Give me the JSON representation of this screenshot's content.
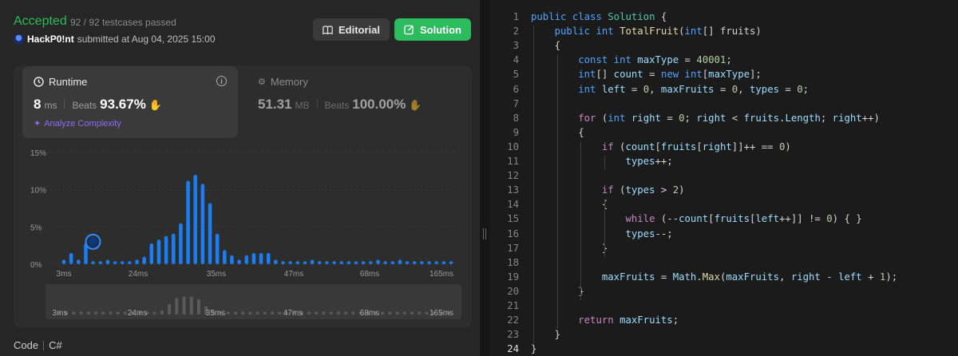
{
  "status": {
    "label": "Accepted",
    "testcases": "92 / 92 testcases passed",
    "user": "HackP0!nt",
    "submitted_text": "submitted at Aug 04, 2025 15:00"
  },
  "buttons": {
    "editorial": "Editorial",
    "solution": "Solution"
  },
  "runtime": {
    "title": "Runtime",
    "value": "8",
    "unit": "ms",
    "beats_label": "Beats",
    "beats_pct": "93.67%",
    "analyze": "Analyze Complexity"
  },
  "memory": {
    "title": "Memory",
    "value": "51.31",
    "unit": "MB",
    "beats_label": "Beats",
    "beats_pct": "100.00%"
  },
  "chart_data": {
    "type": "bar",
    "y_ticks": [
      "15%",
      "10%",
      "5%",
      "0%"
    ],
    "ylim": [
      0,
      15
    ],
    "x_ticks": [
      "3ms",
      "24ms",
      "35ms",
      "47ms",
      "68ms",
      "165ms"
    ],
    "values": [
      0.6,
      1.5,
      0.6,
      2.8,
      0.4,
      0.4,
      0.6,
      0.4,
      0.4,
      0.4,
      0.6,
      1.0,
      2.8,
      3.3,
      3.8,
      4.1,
      5.5,
      11.2,
      12.0,
      10.8,
      8.2,
      4.1,
      1.9,
      1.2,
      0.6,
      1.2,
      1.5,
      1.5,
      1.5,
      0.6,
      0.4,
      0.4,
      0.4,
      0.4,
      0.6,
      0.4,
      0.4,
      0.4,
      0.4,
      0.4,
      0.4,
      0.4,
      0.4,
      0.6,
      0.4,
      0.4,
      0.6,
      0.4,
      0.4,
      0.4,
      0.4,
      0.4,
      0.4,
      0.4
    ],
    "highlight_index": 3,
    "bar_color": "#1a7ef2",
    "mini_values": [
      0.4,
      0.4,
      0.4,
      0.4,
      0.4,
      0.4,
      0.4,
      0.4,
      0.4,
      0.4,
      0.4,
      0.4,
      0.4,
      0.4,
      0.6,
      1.5,
      2.4,
      2.6,
      2.6,
      2.2,
      1.2,
      0.6,
      0.4,
      0.4,
      0.4,
      0.4,
      0.4,
      0.4,
      0.4,
      0.4,
      0.4,
      0.4,
      0.4,
      0.4,
      0.4,
      0.4,
      0.4,
      0.4,
      0.4,
      0.4,
      0.4,
      0.4,
      0.4,
      0.4,
      0.4,
      0.4,
      0.4,
      0.4,
      0.4,
      0.4,
      0.4,
      0.4,
      0.4,
      0.4
    ],
    "mini_x_ticks": [
      "3ms",
      "24ms",
      "35ms",
      "47ms",
      "68ms",
      "165ms"
    ]
  },
  "language": {
    "label": "Code",
    "value": "C#"
  },
  "code": {
    "active_line": 24,
    "lines": [
      [
        [
          "kw",
          "public"
        ],
        [
          "pl",
          " "
        ],
        [
          "kw",
          "class"
        ],
        [
          "pl",
          " "
        ],
        [
          "ty",
          "Solution"
        ],
        [
          "pl",
          " {"
        ]
      ],
      [
        [
          "pl",
          "    "
        ],
        [
          "kw",
          "public"
        ],
        [
          "pl",
          " "
        ],
        [
          "kw",
          "int"
        ],
        [
          "pl",
          " "
        ],
        [
          "fn",
          "TotalFruit"
        ],
        [
          "pl",
          "("
        ],
        [
          "kw",
          "int"
        ],
        [
          "pl",
          "[] fruits)"
        ]
      ],
      [
        [
          "pl",
          "    {"
        ]
      ],
      [
        [
          "pl",
          "        "
        ],
        [
          "kw",
          "const"
        ],
        [
          "pl",
          " "
        ],
        [
          "kw",
          "int"
        ],
        [
          "pl",
          " "
        ],
        [
          "vr",
          "maxType"
        ],
        [
          "pl",
          " = "
        ],
        [
          "nm",
          "40001"
        ],
        [
          "pl",
          ";"
        ]
      ],
      [
        [
          "pl",
          "        "
        ],
        [
          "kw",
          "int"
        ],
        [
          "pl",
          "[] "
        ],
        [
          "vr",
          "count"
        ],
        [
          "pl",
          " = "
        ],
        [
          "kw",
          "new"
        ],
        [
          "pl",
          " "
        ],
        [
          "kw",
          "int"
        ],
        [
          "pl",
          "["
        ],
        [
          "vr",
          "maxType"
        ],
        [
          "pl",
          "];"
        ]
      ],
      [
        [
          "pl",
          "        "
        ],
        [
          "kw",
          "int"
        ],
        [
          "pl",
          " "
        ],
        [
          "vr",
          "left"
        ],
        [
          "pl",
          " = "
        ],
        [
          "nm",
          "0"
        ],
        [
          "pl",
          ", "
        ],
        [
          "vr",
          "maxFruits"
        ],
        [
          "pl",
          " = "
        ],
        [
          "nm",
          "0"
        ],
        [
          "pl",
          ", "
        ],
        [
          "vr",
          "types"
        ],
        [
          "pl",
          " = "
        ],
        [
          "nm",
          "0"
        ],
        [
          "pl",
          ";"
        ]
      ],
      [],
      [
        [
          "pl",
          "        "
        ],
        [
          "ct",
          "for"
        ],
        [
          "pl",
          " ("
        ],
        [
          "kw",
          "int"
        ],
        [
          "pl",
          " "
        ],
        [
          "vr",
          "right"
        ],
        [
          "pl",
          " = "
        ],
        [
          "nm",
          "0"
        ],
        [
          "pl",
          "; "
        ],
        [
          "vr",
          "right"
        ],
        [
          "pl",
          " < "
        ],
        [
          "vr",
          "fruits"
        ],
        [
          "pl",
          "."
        ],
        [
          "vr",
          "Length"
        ],
        [
          "pl",
          "; "
        ],
        [
          "vr",
          "right"
        ],
        [
          "pl",
          "++)"
        ]
      ],
      [
        [
          "pl",
          "        {"
        ]
      ],
      [
        [
          "pl",
          "            "
        ],
        [
          "ct",
          "if"
        ],
        [
          "pl",
          " ("
        ],
        [
          "vr",
          "count"
        ],
        [
          "pl",
          "["
        ],
        [
          "vr",
          "fruits"
        ],
        [
          "pl",
          "["
        ],
        [
          "vr",
          "right"
        ],
        [
          "pl",
          "]]++ == "
        ],
        [
          "nm",
          "0"
        ],
        [
          "pl",
          ")"
        ]
      ],
      [
        [
          "pl",
          "                "
        ],
        [
          "vr",
          "types"
        ],
        [
          "pl",
          "++;"
        ]
      ],
      [],
      [
        [
          "pl",
          "            "
        ],
        [
          "ct",
          "if"
        ],
        [
          "pl",
          " ("
        ],
        [
          "vr",
          "types"
        ],
        [
          "pl",
          " > "
        ],
        [
          "nm",
          "2"
        ],
        [
          "pl",
          ")"
        ]
      ],
      [
        [
          "pl",
          "            {"
        ]
      ],
      [
        [
          "pl",
          "                "
        ],
        [
          "ct",
          "while"
        ],
        [
          "pl",
          " (--"
        ],
        [
          "vr",
          "count"
        ],
        [
          "pl",
          "["
        ],
        [
          "vr",
          "fruits"
        ],
        [
          "pl",
          "["
        ],
        [
          "vr",
          "left"
        ],
        [
          "pl",
          "++]] != "
        ],
        [
          "nm",
          "0"
        ],
        [
          "pl",
          ") { }"
        ]
      ],
      [
        [
          "pl",
          "                "
        ],
        [
          "vr",
          "types"
        ],
        [
          "pl",
          "--;"
        ]
      ],
      [
        [
          "pl",
          "            }"
        ]
      ],
      [],
      [
        [
          "pl",
          "            "
        ],
        [
          "vr",
          "maxFruits"
        ],
        [
          "pl",
          " = "
        ],
        [
          "vr",
          "Math"
        ],
        [
          "pl",
          "."
        ],
        [
          "fn",
          "Max"
        ],
        [
          "pl",
          "("
        ],
        [
          "vr",
          "maxFruits"
        ],
        [
          "pl",
          ", "
        ],
        [
          "vr",
          "right"
        ],
        [
          "pl",
          " - "
        ],
        [
          "vr",
          "left"
        ],
        [
          "pl",
          " + "
        ],
        [
          "nm",
          "1"
        ],
        [
          "pl",
          ");"
        ]
      ],
      [
        [
          "pl",
          "        }"
        ]
      ],
      [],
      [
        [
          "pl",
          "        "
        ],
        [
          "ct",
          "return"
        ],
        [
          "pl",
          " "
        ],
        [
          "vr",
          "maxFruits"
        ],
        [
          "pl",
          ";"
        ]
      ],
      [
        [
          "pl",
          "    }"
        ]
      ],
      [
        [
          "pl",
          "}"
        ]
      ]
    ]
  },
  "icons": {
    "editorial": "book-icon",
    "solution": "edit-icon",
    "runtime": "clock-icon",
    "memory": "chip-icon",
    "analyze": "sparkle-icon",
    "info": "info-icon"
  }
}
